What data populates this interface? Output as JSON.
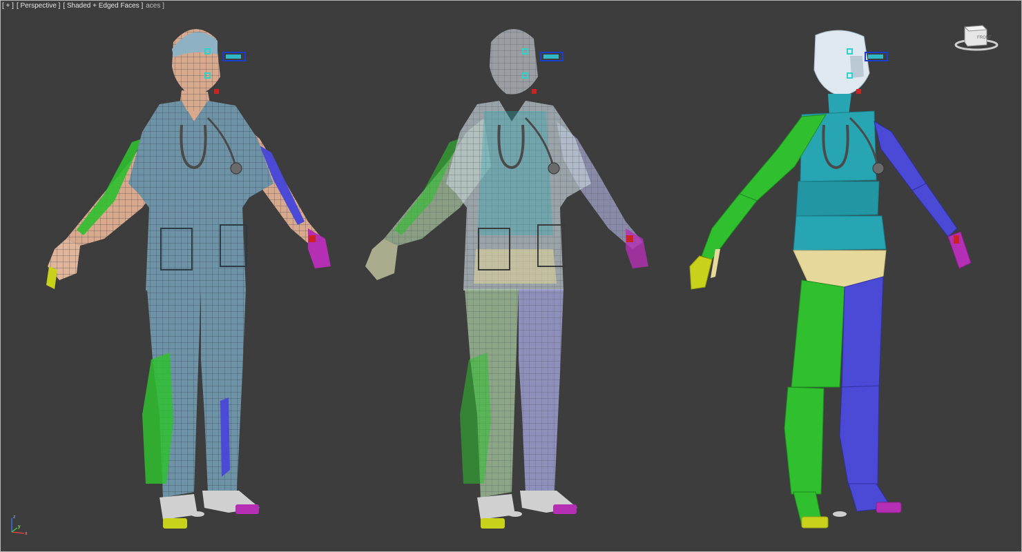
{
  "viewport": {
    "label_plus": "[ + ]",
    "label_view": "[ Perspective ]",
    "label_shading": "[ Shaded + Edged Faces ]",
    "label_extra": "aces ]",
    "viewcube_face": "FRONT"
  },
  "axes": {
    "x": "x",
    "y": "y",
    "z": "z"
  },
  "figures": [
    {
      "name": "skinned-mesh-opaque",
      "display": "shaded textured mesh with bone overlays"
    },
    {
      "name": "skinned-mesh-xray",
      "display": "see-through mesh with bone overlays"
    },
    {
      "name": "bone-proxy-rig",
      "display": "colored bone proxies"
    }
  ],
  "colors": {
    "background": "#3d3d3d",
    "scrubs": "#6f93a6",
    "skin": "#d9a98e",
    "bone_left": "#2fbf2f",
    "bone_right": "#4a4ad6",
    "bone_spine": "#27a5b3",
    "bone_pelvis": "#e6d79b",
    "bone_head": "#dfe8ef",
    "foot_left": "#c8d21a",
    "foot_right": "#b52fb5"
  }
}
